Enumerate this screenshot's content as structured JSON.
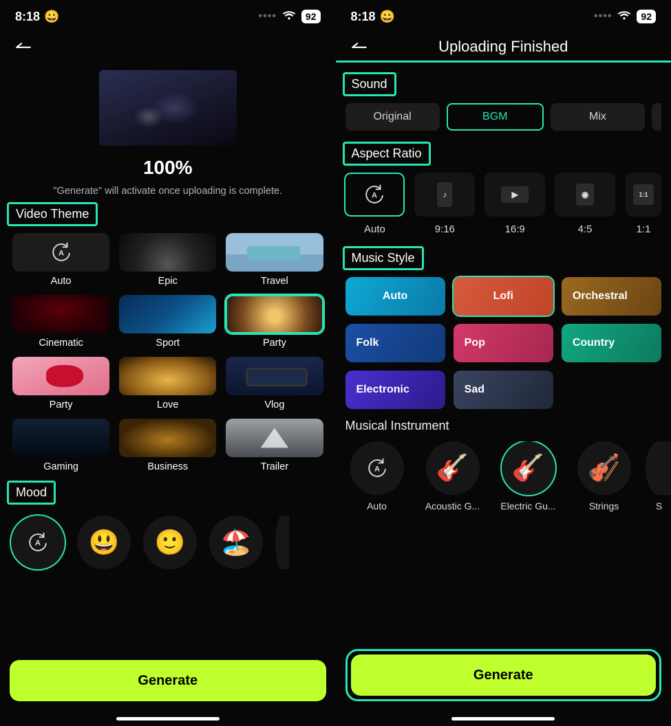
{
  "status": {
    "time": "8:18",
    "emoji": "😀",
    "battery": "92"
  },
  "left": {
    "upload": {
      "percent": "100%",
      "hint": "\"Generate\" will activate once uploading is complete."
    },
    "sections": {
      "video_theme": "Video Theme",
      "mood": "Mood"
    },
    "themes": [
      {
        "label": "Auto"
      },
      {
        "label": "Epic"
      },
      {
        "label": "Travel"
      },
      {
        "label": "Cinematic"
      },
      {
        "label": "Sport"
      },
      {
        "label": "Party"
      },
      {
        "label": "Party"
      },
      {
        "label": "Love"
      },
      {
        "label": "Vlog"
      },
      {
        "label": "Gaming"
      },
      {
        "label": "Business"
      },
      {
        "label": "Trailer"
      }
    ],
    "moods": [
      {
        "icon": "auto"
      },
      {
        "icon": "😃"
      },
      {
        "icon": "🙂"
      },
      {
        "icon": "🏖️"
      }
    ],
    "generate": "Generate"
  },
  "right": {
    "title": "Uploading Finished",
    "sections": {
      "sound": "Sound",
      "aspect": "Aspect Ratio",
      "music_style": "Music Style",
      "instrument": "Musical Instrument"
    },
    "sound": [
      {
        "label": "Original"
      },
      {
        "label": "BGM"
      },
      {
        "label": "Mix"
      }
    ],
    "aspect": [
      {
        "label": "Auto"
      },
      {
        "label": "9:16"
      },
      {
        "label": "16:9"
      },
      {
        "label": "4:5"
      },
      {
        "label": "1:1"
      }
    ],
    "styles": [
      {
        "label": "Auto"
      },
      {
        "label": "Lofi"
      },
      {
        "label": "Orchestral"
      },
      {
        "label": "Folk"
      },
      {
        "label": "Pop"
      },
      {
        "label": "Country"
      },
      {
        "label": "Electronic"
      },
      {
        "label": "Sad"
      }
    ],
    "instruments": [
      {
        "label": "Auto"
      },
      {
        "label": "Acoustic G..."
      },
      {
        "label": "Electric Gu..."
      },
      {
        "label": "Strings"
      },
      {
        "label": "S"
      }
    ],
    "generate": "Generate"
  }
}
